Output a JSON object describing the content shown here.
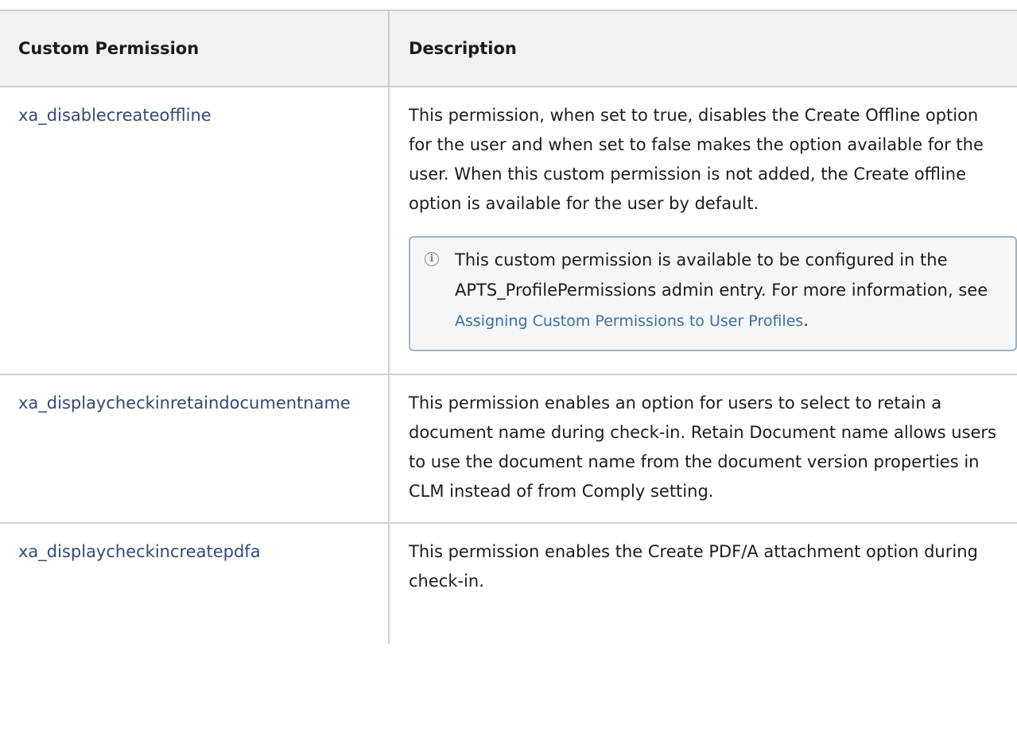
{
  "table": {
    "headers": [
      "Custom Permission",
      "Description"
    ],
    "rows": [
      {
        "permission": "xa_disablecreateoffline",
        "description": "This permission, when set to true, disables the Create Offline option for the user and when set to false makes the option available for the user. When this custom permission is not added, the Create offline option is available for the user by default.",
        "note": {
          "icon": "info-icon",
          "text_before": "This custom permission is available to be configured in the APTS_ProfilePermissions admin entry. For more information, see ",
          "link_text": "Assigning Custom Permissions to User Profiles",
          "text_after": "."
        }
      },
      {
        "permission": "xa_displaycheckinretaindocumentname",
        "description": "This permission enables an option for users to select to retain a document name during check-in. Retain Document name allows users to use the document name from the document version properties in CLM instead of from Comply setting."
      },
      {
        "permission": "xa_displaycheckincreatepdfa",
        "description": "This permission enables the Create PDF/A attachment option during check-in."
      }
    ]
  }
}
